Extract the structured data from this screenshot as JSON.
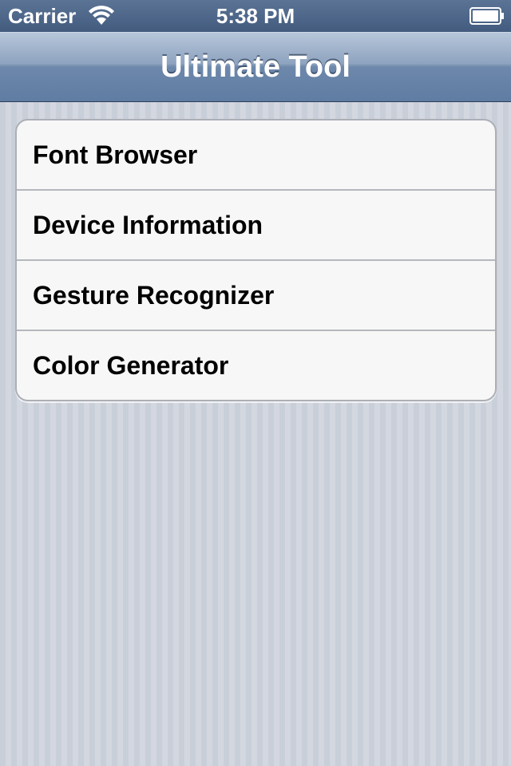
{
  "status_bar": {
    "carrier": "Carrier",
    "time": "5:38 PM",
    "wifi_icon": "wifi-icon",
    "battery_icon": "battery-icon"
  },
  "nav_bar": {
    "title": "Ultimate Tool"
  },
  "menu": {
    "items": [
      {
        "label": "Font Browser"
      },
      {
        "label": "Device Information"
      },
      {
        "label": "Gesture Recognizer"
      },
      {
        "label": "Color Generator"
      }
    ]
  },
  "colors": {
    "status_bar": "#4a6387",
    "nav_bar": "#7089ab",
    "background": "#cdd2dc",
    "cell_background": "#f7f7f7"
  }
}
